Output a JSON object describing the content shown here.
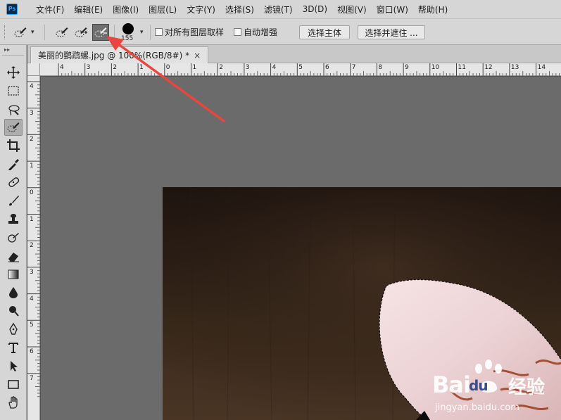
{
  "app": {
    "logo_text": "Ps"
  },
  "menubar": {
    "items": [
      "文件(F)",
      "编辑(E)",
      "图像(I)",
      "图层(L)",
      "文字(Y)",
      "选择(S)",
      "滤镜(T)",
      "3D(D)",
      "视图(V)",
      "窗口(W)",
      "帮助(H)"
    ]
  },
  "options": {
    "brush_size": "155",
    "sample_all_layers_label": "对所有图层取样",
    "sample_all_layers_checked": false,
    "auto_enhance_label": "自动增强",
    "auto_enhance_checked": false,
    "select_subject_label": "选择主体",
    "select_and_mask_label": "选择并遮住 ..."
  },
  "document": {
    "tab_title": "美丽的鹦鹉螺.jpg @ 100%(RGB/8#) *",
    "close_glyph": "×"
  },
  "rulers": {
    "horizontal": [
      "4",
      "3",
      "2",
      "1",
      "0",
      "1",
      "2",
      "3",
      "4",
      "5",
      "6",
      "7",
      "8",
      "9",
      "10",
      "11",
      "12",
      "13",
      "14"
    ],
    "vertical": [
      "4",
      "3",
      "2",
      "1",
      "0",
      "1",
      "2",
      "3",
      "4",
      "5",
      "6",
      "7"
    ]
  },
  "tools": [
    {
      "name": "move-icon",
      "active": false
    },
    {
      "name": "marquee-icon",
      "active": false
    },
    {
      "name": "lasso-icon",
      "active": false
    },
    {
      "name": "quick-selection-icon",
      "active": true
    },
    {
      "name": "crop-icon",
      "active": false
    },
    {
      "name": "eyedropper-icon",
      "active": false
    },
    {
      "name": "healing-brush-icon",
      "active": false
    },
    {
      "name": "brush-icon",
      "active": false
    },
    {
      "name": "clone-stamp-icon",
      "active": false
    },
    {
      "name": "history-brush-icon",
      "active": false
    },
    {
      "name": "eraser-icon",
      "active": false
    },
    {
      "name": "gradient-icon",
      "active": false
    },
    {
      "name": "blur-icon",
      "active": false
    },
    {
      "name": "dodge-icon",
      "active": false
    },
    {
      "name": "pen-icon",
      "active": false
    },
    {
      "name": "type-icon",
      "active": false
    },
    {
      "name": "path-selection-icon",
      "active": false
    },
    {
      "name": "rectangle-icon",
      "active": false
    },
    {
      "name": "hand-icon",
      "active": false
    }
  ],
  "watermark": {
    "logo_text": "Bai",
    "logo_suffix": "du",
    "title": "经验",
    "url": "jingyan.baidu.com"
  },
  "colors": {
    "annotation_arrow": "#e8463f",
    "ui_panel": "#d6d6d6",
    "pasteboard": "#6b6b6b"
  }
}
